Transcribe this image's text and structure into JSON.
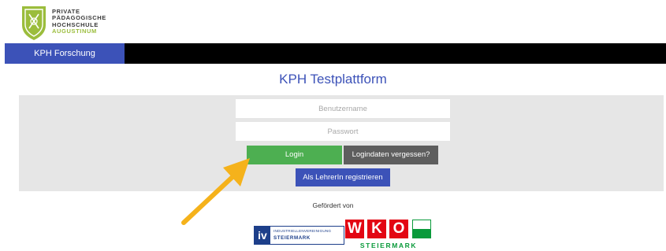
{
  "logo": {
    "line1": "PRIVATE",
    "line2": "PÄDAGOGISCHE",
    "line3": "HOCHSCHULE",
    "line4": "AUGUSTINUM",
    "icon": "shield-icon"
  },
  "nav": {
    "tab_label": "KPH Forschung"
  },
  "page": {
    "title": "KPH Testplattform"
  },
  "login": {
    "username_placeholder": "Benutzername",
    "username_value": "",
    "password_placeholder": "Passwort",
    "password_value": "",
    "login_label": "Login",
    "forgot_label": "Logindaten vergessen?",
    "register_label": "Als LehrerIn registrieren"
  },
  "annotation": {
    "icon": "arrow-icon",
    "color": "#f5b21b"
  },
  "footer": {
    "sponsor_label": "Gefördert von",
    "iv": {
      "mark": "iv",
      "line1": "INDUSTRIELLENVEREINIGUNG",
      "line2": "STEIERMARK"
    },
    "wko": {
      "l1": "W",
      "l2": "K",
      "l3": "O",
      "sub": "STEIERMARK"
    }
  },
  "colors": {
    "accent": "#3c52b8",
    "login": "#4daf51",
    "forgot": "#5e5e5e",
    "panel": "#e6e6e6",
    "wko_red": "#e30613",
    "wko_green": "#0a9a3b"
  }
}
